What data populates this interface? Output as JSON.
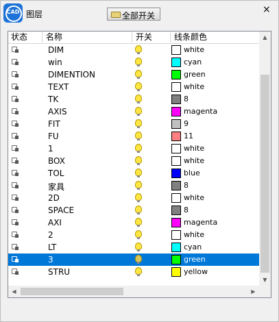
{
  "window": {
    "icon_label": "CAD",
    "title": "图层",
    "all_switch_label": "全部开关",
    "close_symbol": "×"
  },
  "columns": [
    "状态",
    "名称",
    "开关",
    "线条颜色"
  ],
  "rows": [
    {
      "name": "DIM",
      "color_name": "white",
      "color": "#ffffff",
      "on": true
    },
    {
      "name": "win",
      "color_name": "cyan",
      "color": "#00ffff",
      "on": true
    },
    {
      "name": "DIMENTION",
      "color_name": "green",
      "color": "#00ff00",
      "on": true
    },
    {
      "name": "TEXT",
      "color_name": "white",
      "color": "#ffffff",
      "on": true
    },
    {
      "name": "TK",
      "color_name": "8",
      "color": "#808080",
      "on": true
    },
    {
      "name": "AXIS",
      "color_name": "magenta",
      "color": "#ff00ff",
      "on": true
    },
    {
      "name": "FIT",
      "color_name": "9",
      "color": "#c0c0c0",
      "on": true
    },
    {
      "name": "FU",
      "color_name": "11",
      "color": "#ff8080",
      "on": true
    },
    {
      "name": "1",
      "color_name": "white",
      "color": "#ffffff",
      "on": true
    },
    {
      "name": "BOX",
      "color_name": "white",
      "color": "#ffffff",
      "on": true
    },
    {
      "name": "TOL",
      "color_name": "blue",
      "color": "#0000ff",
      "on": true
    },
    {
      "name": "家具",
      "color_name": "8",
      "color": "#808080",
      "on": true
    },
    {
      "name": "2D",
      "color_name": "white",
      "color": "#ffffff",
      "on": true
    },
    {
      "name": "SPACE",
      "color_name": "8",
      "color": "#808080",
      "on": true
    },
    {
      "name": "AXI",
      "color_name": "magenta",
      "color": "#ff00ff",
      "on": true
    },
    {
      "name": "2",
      "color_name": "white",
      "color": "#ffffff",
      "on": true
    },
    {
      "name": "LT",
      "color_name": "cyan",
      "color": "#00ffff",
      "on": true
    },
    {
      "name": "3",
      "color_name": "green",
      "color": "#00ff00",
      "on": true,
      "selected": true
    },
    {
      "name": "STRU",
      "color_name": "yellow",
      "color": "#ffff00",
      "on": true
    }
  ],
  "colors": {
    "selection": "#0078d7",
    "accent": "#1e73d8"
  }
}
